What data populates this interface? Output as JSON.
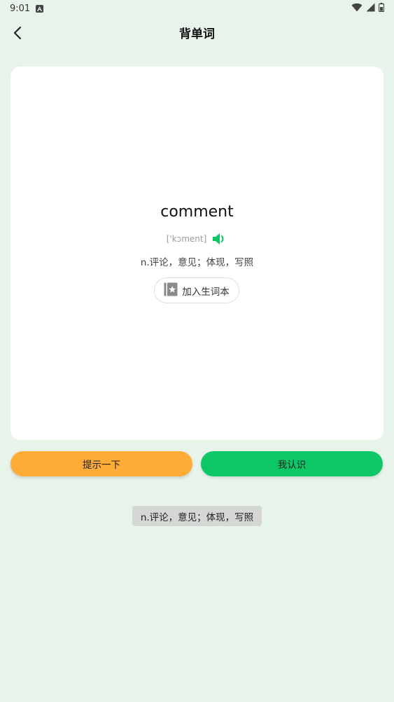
{
  "status_bar": {
    "time": "9:01",
    "notification_icon": "a-box-icon",
    "icons": [
      "wifi-icon",
      "signal-icon",
      "battery-icon"
    ]
  },
  "app_bar": {
    "title": "背单词",
    "back_icon": "chevron-left-icon"
  },
  "card": {
    "word": "comment",
    "phonetic": "['kɔment]",
    "speaker_icon": "speaker-icon",
    "meaning": "n.评论，意见；体现，写照",
    "add_vocab_label": "加入生词本",
    "add_vocab_icon": "bookmark-star-icon"
  },
  "actions": {
    "hint_label": "提示一下",
    "know_label": "我认识"
  },
  "toast": {
    "text": "n.评论，意见；体现，写照"
  },
  "colors": {
    "background": "#e8f3ea",
    "hint_button": "#ffab38",
    "know_button": "#0ec767",
    "speaker": "#0ec767"
  }
}
